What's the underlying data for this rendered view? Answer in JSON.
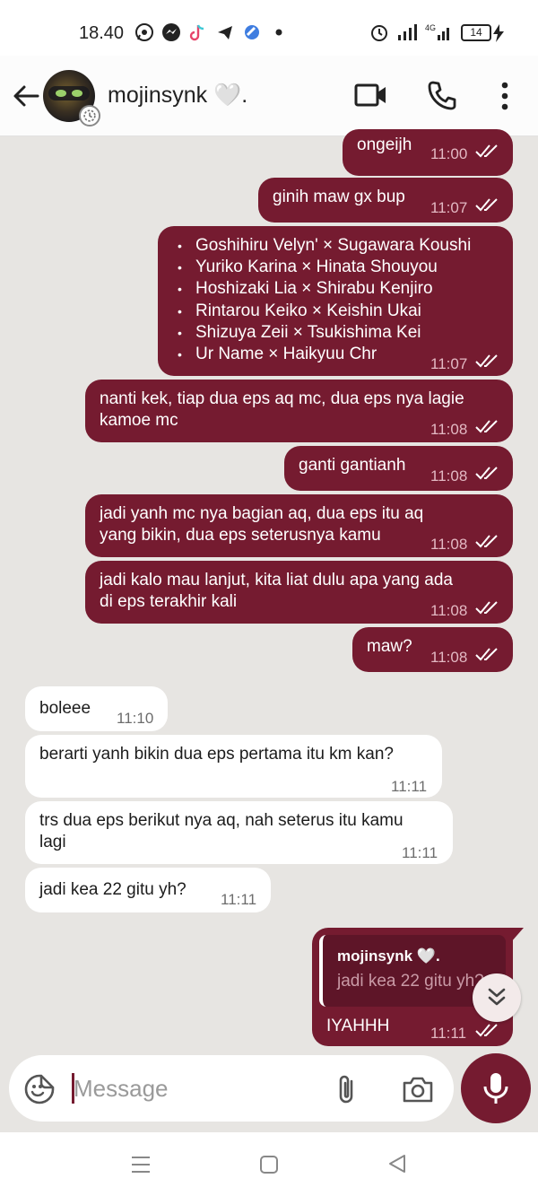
{
  "status_bar": {
    "time": "18.40",
    "battery": "14",
    "network": "4G",
    "app_icons": [
      "whatsapp-icon",
      "messenger-icon",
      "tiktok-icon",
      "telegram-icon",
      "app-icon",
      "dot-icon"
    ],
    "right_icons": [
      "alarm-icon",
      "signal-icon",
      "4g-signal-icon",
      "battery-icon",
      "charging-icon"
    ]
  },
  "header": {
    "contact_name": "mojinsynk 🤍."
  },
  "messages": [
    {
      "text": "ongeijh",
      "time": "11:00",
      "dir": "out"
    },
    {
      "text": "ginih maw gx bup",
      "time": "11:07",
      "dir": "out"
    },
    {
      "items": [
        "Goshihiru Velyn' × Sugawara Koushi",
        "Yuriko Karina × Hinata Shouyou",
        "Hoshizaki Lia × Shirabu Kenjiro",
        "Rintarou Keiko × Keishin Ukai",
        "Shizuya Zeii × Tsukishima Kei",
        "Ur Name × Haikyuu Chr"
      ],
      "time": "11:07",
      "dir": "out"
    },
    {
      "line1": "nanti kek, tiap dua eps aq mc, dua eps nya lagie",
      "line2": "kamoe mc",
      "time": "11:08",
      "dir": "out"
    },
    {
      "text": "ganti gantianh",
      "time": "11:08",
      "dir": "out"
    },
    {
      "line1": "jadi yanh mc nya bagian aq, dua eps itu aq",
      "line2": "yang bikin, dua eps seterusnya kamu",
      "time": "11:08",
      "dir": "out"
    },
    {
      "line1": "jadi kalo mau lanjut, kita liat dulu apa yang ada",
      "line2": "di eps terakhir kali",
      "time": "11:08",
      "dir": "out"
    },
    {
      "text": "maw?",
      "time": "11:08",
      "dir": "out"
    },
    {
      "text": "boleee",
      "time": "11:10",
      "dir": "in"
    },
    {
      "text": "berarti yanh bikin dua eps pertama itu km kan?",
      "time": "11:11",
      "dir": "in"
    },
    {
      "line1": "trs dua eps berikut nya aq, nah seterus itu kamu",
      "line2": "lagi",
      "time": "11:11",
      "dir": "in"
    },
    {
      "text": "jadi kea 22 gitu yh?",
      "time": "11:11",
      "dir": "in"
    },
    {
      "quote_name": "mojinsynk 🤍.",
      "quote_text": "jadi kea 22 gitu yh?",
      "text": "IYAHHH",
      "time": "11:11",
      "dir": "out"
    }
  ],
  "input": {
    "placeholder": "Message"
  },
  "colors": {
    "outgoing_bubble": "#751b30",
    "chat_background": "#e7e5e2",
    "incoming_bubble": "#ffffff"
  }
}
